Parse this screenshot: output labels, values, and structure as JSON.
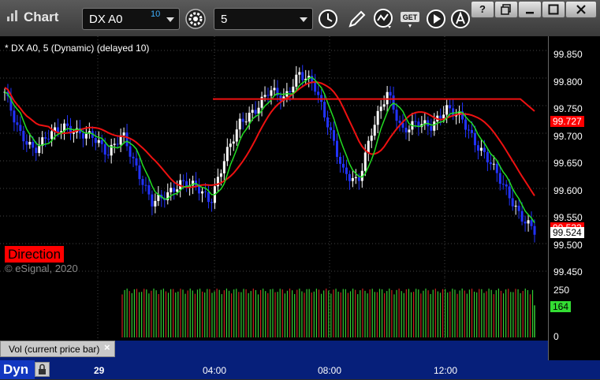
{
  "app": {
    "title": "Chart"
  },
  "toolbar": {
    "symbol": "DX A0",
    "symbol_superscript": "10",
    "interval": "5",
    "buttons": [
      "settings-gear-icon",
      "clock-icon",
      "pencil-icon",
      "indicator-icon",
      "get-icon",
      "play-icon",
      "text-icon"
    ],
    "window_buttons": [
      "?",
      "restore",
      "minimize",
      "maximize",
      "close"
    ],
    "get_text": "GET",
    "help_text": "?"
  },
  "chart": {
    "study_label": "* DX A0, 5 (Dynamic) (delayed 10)",
    "direction_label": "Direction",
    "watermark": "© eSignal, 2020",
    "price_axis": [
      "99.850",
      "99.800",
      "99.750",
      "99.700",
      "99.650",
      "99.600",
      "99.550",
      "99.500",
      "99.450"
    ],
    "price_tags": {
      "red_line": "99.727",
      "ma_overlap": "99.532",
      "last": "99.524"
    },
    "volume_axis": [
      "250",
      "0"
    ],
    "volume_tag": "164",
    "volume_label": "Vol (current price bar)",
    "volume_close": "×",
    "time_axis": [
      "29",
      "04:00",
      "08:00",
      "12:00"
    ],
    "mode": "Dyn",
    "colors": {
      "up": "#ffffff",
      "down": "#2233ff",
      "fast_ma": "#22dd22",
      "slow_ma": "#ee1111",
      "vol_up": "#33cc33",
      "vol_down": "#cc2222"
    }
  },
  "chart_data": {
    "type": "line",
    "x": [
      "29",
      "04:00",
      "08:00",
      "12:00"
    ],
    "ylim": [
      99.45,
      99.85
    ],
    "series": [
      {
        "values": [
          99.775,
          99.7,
          99.668,
          99.698,
          99.712,
          99.7,
          99.695,
          99.662,
          99.7,
          99.632,
          99.575,
          99.588,
          99.61,
          99.605,
          99.575,
          99.66,
          99.72,
          99.74,
          99.78,
          99.762,
          99.808,
          99.79,
          99.712,
          99.63,
          99.61,
          99.71,
          99.775,
          99.703,
          99.72,
          99.712,
          99.745,
          99.73,
          99.68,
          99.648,
          99.6,
          99.55,
          99.524
        ]
      }
    ]
  }
}
